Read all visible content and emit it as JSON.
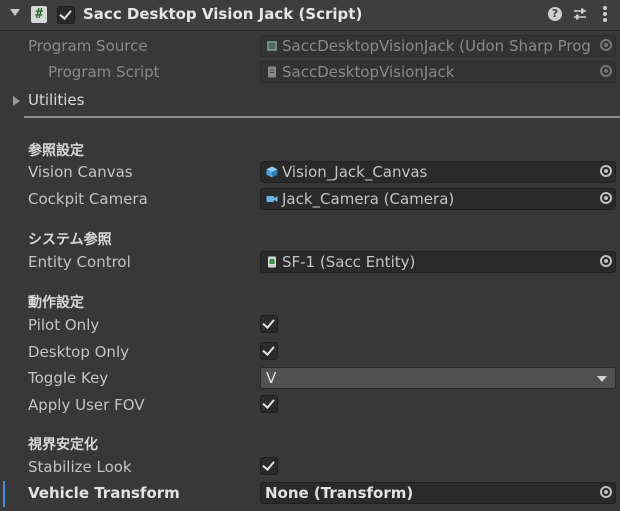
{
  "header": {
    "title": "Sacc Desktop Vision Jack (Script)",
    "enabled": true,
    "icons": [
      "foldout-arrow-icon",
      "csharp-script-icon",
      "help-icon",
      "presets-icon",
      "kebab-menu-icon"
    ]
  },
  "program_source": {
    "label": "Program Source",
    "value": "SaccDesktopVisionJack (Udon Sharp Prog",
    "icon": "udon-program-asset-icon"
  },
  "program_script": {
    "label": "Program Script",
    "value": "SaccDesktopVisionJack",
    "icon": "csharp-script-icon"
  },
  "utilities": {
    "label": "Utilities"
  },
  "sections": {
    "reference": "参照設定",
    "system": "システム参照",
    "behavior": "動作設定",
    "stabilize": "視界安定化"
  },
  "fields": {
    "vision_canvas": {
      "label": "Vision Canvas",
      "value": "Vision_Jack_Canvas",
      "icon": "gameobject-cube-icon"
    },
    "cockpit_camera": {
      "label": "Cockpit Camera",
      "value": "Jack_Camera (Camera)",
      "icon": "camera-icon"
    },
    "entity_control": {
      "label": "Entity Control",
      "value": "SF-1 (Sacc Entity)",
      "icon": "csharp-script-icon"
    },
    "pilot_only": {
      "label": "Pilot Only",
      "checked": true
    },
    "desktop_only": {
      "label": "Desktop Only",
      "checked": true
    },
    "toggle_key": {
      "label": "Toggle Key",
      "value": "V"
    },
    "apply_user_fov": {
      "label": "Apply User FOV",
      "checked": true
    },
    "stabilize_look": {
      "label": "Stabilize Look",
      "checked": true
    },
    "vehicle_transform": {
      "label": "Vehicle Transform",
      "value": "None (Transform)"
    }
  },
  "colors": {
    "background": "#383838",
    "field": "#2a2a2a",
    "accent": "#4a90d9"
  }
}
